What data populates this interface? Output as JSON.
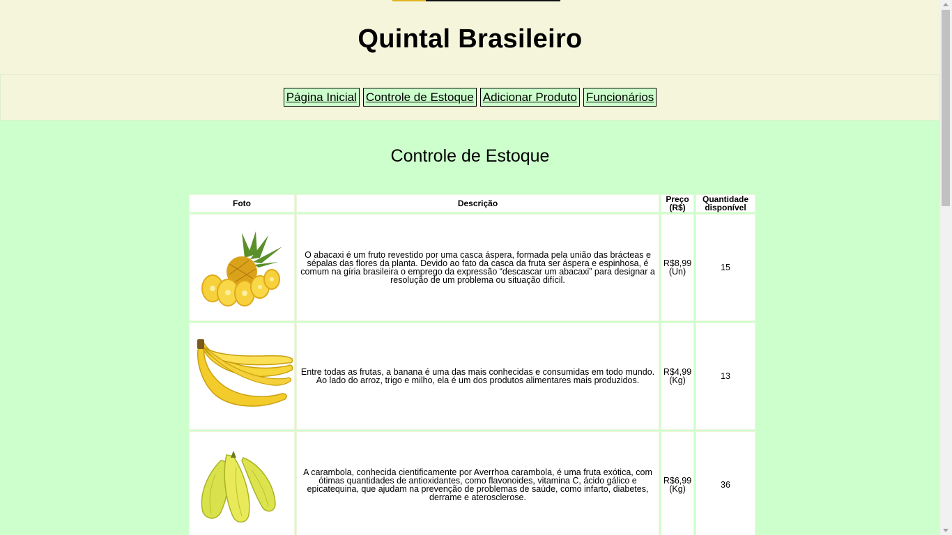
{
  "header": {
    "title": "Quintal Brasileiro"
  },
  "nav": [
    {
      "label": "Página Inicial"
    },
    {
      "label": "Controle de Estoque"
    },
    {
      "label": "Adicionar Produto"
    },
    {
      "label": "Funcionários"
    }
  ],
  "main": {
    "heading": "Controle de Estoque"
  },
  "table": {
    "headers": {
      "foto": "Foto",
      "descricao": "Descrição",
      "preco": "Preço (R$)",
      "quantidade": "Quantidade disponível"
    },
    "rows": [
      {
        "image": "pineapple-image",
        "descricao": "O abacaxi é um fruto revestido por uma casca áspera, formada pela união das brácteas e sépalas das flores da planta. Devido ao fato da casca da fruta ser áspera e espinhosa, é comum na gíria brasileira o emprego da expressão “descascar um abacaxi” para designar a resolução de um problema ou situação difícil.",
        "preco": "R$8,99 (Un)",
        "quantidade": "15"
      },
      {
        "image": "banana-image",
        "descricao": "Entre todas as frutas, a banana é uma das mais conhecidas e consumidas em todo mundo. Ao lado do arroz, trigo e milho, ela é um dos produtos alimentares mais produzidos.",
        "preco": "R$4,99 (Kg)",
        "quantidade": "13"
      },
      {
        "image": "starfruit-image",
        "descricao": "A carambola, conhecida cientificamente por Averrhoa carambola, é uma fruta exótica, com ótimas quantidades de antioxidantes, como flavonoides, vitamina C, ácido gálico e epicatequina, que ajudam na prevenção de problemas de saúde, como infarto, diabetes, derrame e aterosclerose.",
        "preco": "R$6,99 (Kg)",
        "quantidade": "36"
      }
    ]
  },
  "colors": {
    "page_bg": "#ccffcc",
    "header_bg": "#f5f5dc",
    "accent": "#e3b41f"
  }
}
